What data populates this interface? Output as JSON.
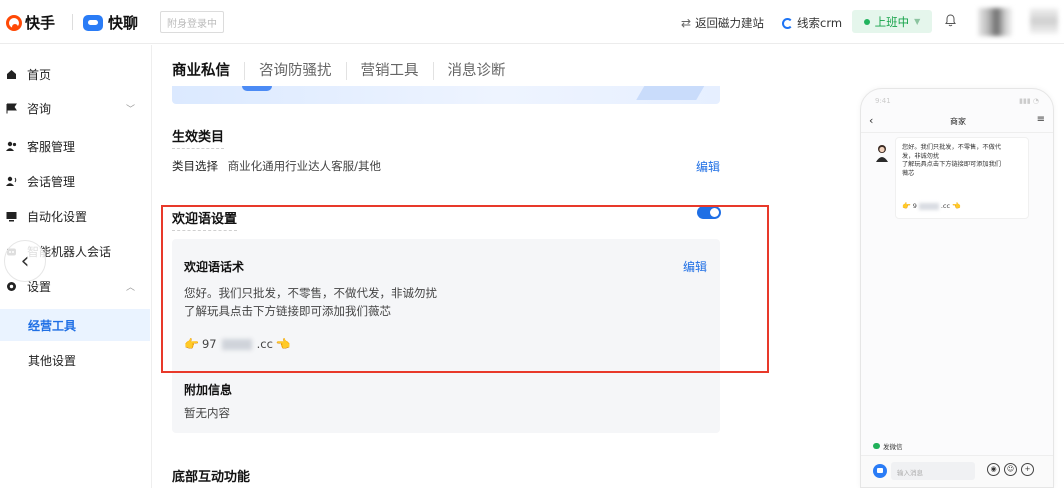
{
  "header": {
    "brand_primary": "快手",
    "brand_secondary": "快聊",
    "sub_account_placeholder": "附身登录中",
    "link_back": "返回磁力建站",
    "link_crm": "线索crm",
    "status_label": "上班中",
    "brand_color": "#ff4906",
    "accent_color": "#1f6fe5"
  },
  "sidebar": {
    "items": [
      {
        "label": "首页",
        "icon": "home-icon"
      },
      {
        "label": "咨询",
        "icon": "flag-icon",
        "expanded": false
      },
      {
        "label": "客服管理",
        "icon": "users-icon"
      },
      {
        "label": "会话管理",
        "icon": "user-voice-icon"
      },
      {
        "label": "自动化设置",
        "icon": "monitor-icon"
      },
      {
        "label": "智能机器人会话",
        "icon": "robot-icon"
      },
      {
        "label": "设置",
        "icon": "gear-icon",
        "expanded": true
      }
    ],
    "sub_items": [
      {
        "label": "经营工具",
        "active": true
      },
      {
        "label": "其他设置",
        "active": false
      }
    ]
  },
  "main": {
    "tabs": [
      {
        "label": "商业私信",
        "active": true
      },
      {
        "label": "咨询防骚扰",
        "active": false
      },
      {
        "label": "营销工具",
        "active": false
      },
      {
        "label": "消息诊断",
        "active": false
      }
    ],
    "effective_category": {
      "title": "生效类目",
      "field_label": "类目选择",
      "field_value": "商业化通用行业达人客服/其他",
      "edit_label": "编辑"
    },
    "welcome": {
      "title": "欢迎语设置",
      "enabled": true,
      "script_title": "欢迎语话术",
      "edit_label": "编辑",
      "line1": "您好。我们只批发，不零售，不做代发，非诚勿扰",
      "line2": "了解玩具点击下方链接即可添加我们薇芯",
      "link_prefix": "97",
      "link_suffix": ".cc",
      "extra_title": "附加信息",
      "extra_value": "暂无内容"
    },
    "bottom_section_title": "底部互动功能"
  },
  "preview": {
    "title": "商家",
    "message_line1": "您好。我们只批发，不零售，不做代",
    "message_line2": "发，非诚勿扰",
    "message_line3": "了解玩具点击下方链接即可添加我们",
    "message_line4": "薇芯",
    "link_prefix": "9",
    "link_suffix": ".cc",
    "wechat_label": "发微信",
    "input_placeholder": "输入消息"
  }
}
